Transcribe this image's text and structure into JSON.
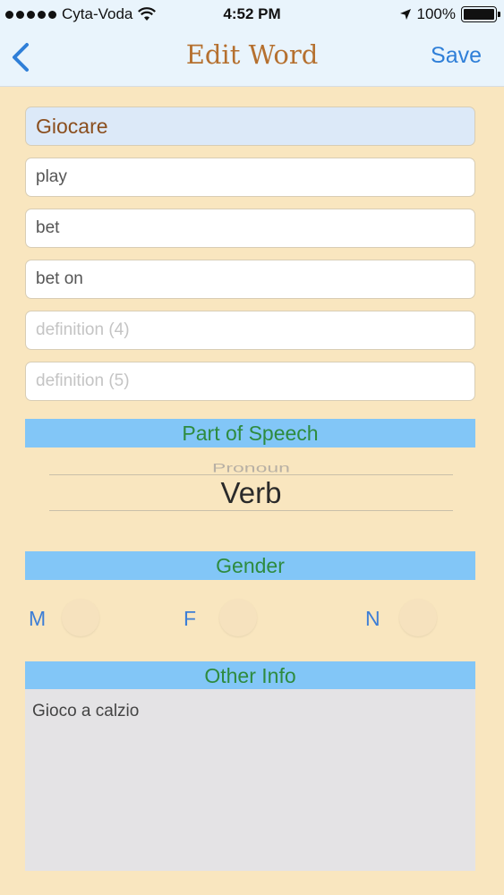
{
  "status_bar": {
    "carrier": "Cyta-Voda",
    "time": "4:52 PM",
    "battery": "100%"
  },
  "nav": {
    "title": "Edit Word",
    "save_label": "Save"
  },
  "form": {
    "word": "Giocare",
    "definitions": [
      {
        "value": "play",
        "placeholder": ""
      },
      {
        "value": "bet",
        "placeholder": ""
      },
      {
        "value": "bet on",
        "placeholder": ""
      },
      {
        "value": "",
        "placeholder": "definition (4)"
      },
      {
        "value": "",
        "placeholder": "definition (5)"
      }
    ]
  },
  "part_of_speech": {
    "header": "Part of Speech",
    "previous_option": "Pronoun",
    "selected": "Verb"
  },
  "gender": {
    "header": "Gender",
    "options": [
      "M",
      "F",
      "N"
    ]
  },
  "other_info": {
    "header": "Other Info",
    "text": "Gioco a calzio"
  },
  "colors": {
    "background": "#f9e6bf",
    "nav_background": "#e9f4fc",
    "section_bar": "#82c6f7",
    "section_text": "#2e8b3f",
    "accent": "#2f7fd8",
    "title": "#b5702f"
  }
}
